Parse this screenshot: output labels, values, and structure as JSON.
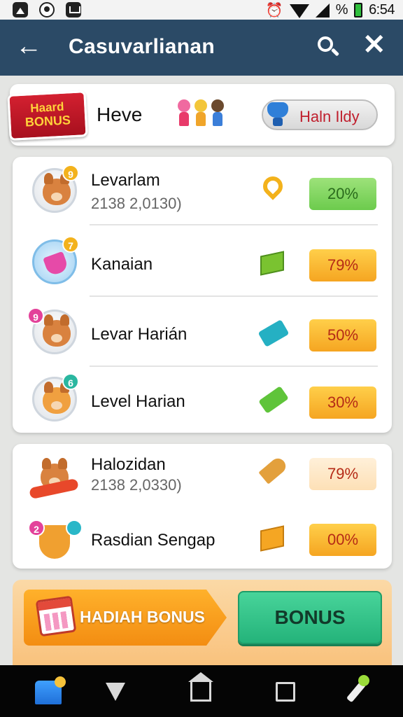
{
  "status_bar": {
    "clock": "6:54",
    "battery_text": "%"
  },
  "app_bar": {
    "title": "Casuvarlianan"
  },
  "banner": {
    "badge_line1": "Haard",
    "badge_line2": "BONUS",
    "heading": "Heve",
    "pill_label": "Haln Ildy"
  },
  "list_group_1": [
    {
      "name": "Levarlam",
      "subtitle": "2138 2,0130)",
      "badge": "9",
      "icon": "key-pin-icon",
      "percent": "20%",
      "percent_style": "green"
    },
    {
      "name": "Kanaian",
      "subtitle": "",
      "badge": "7",
      "icon": "gift-box-icon",
      "percent": "79%",
      "percent_style": "orange"
    },
    {
      "name": "Levar Harián",
      "subtitle": "",
      "badge": "9",
      "icon": "ticket-icon",
      "percent": "50%",
      "percent_style": "orange"
    },
    {
      "name": "Level Harian",
      "subtitle": "",
      "badge": "6",
      "icon": "ticket-icon",
      "percent": "30%",
      "percent_style": "orange"
    }
  ],
  "list_group_2": [
    {
      "name": "Halozidan",
      "subtitle": "2138 2,0330)",
      "icon": "horn-icon",
      "percent": "79%",
      "percent_style": "pale"
    },
    {
      "name": "Rasdian Sengap",
      "subtitle": "",
      "badge": "2",
      "icon": "cube-icon",
      "percent": "00%",
      "percent_style": "orange"
    }
  ],
  "bonus": {
    "ribbon_label": "HADIAH BONUS",
    "button_label": "BONUS"
  },
  "colors": {
    "app_bar": "#2b4a66",
    "percent_green": "#6ccb4d",
    "percent_orange": "#f5a521",
    "bonus_button": "#24b37a"
  }
}
